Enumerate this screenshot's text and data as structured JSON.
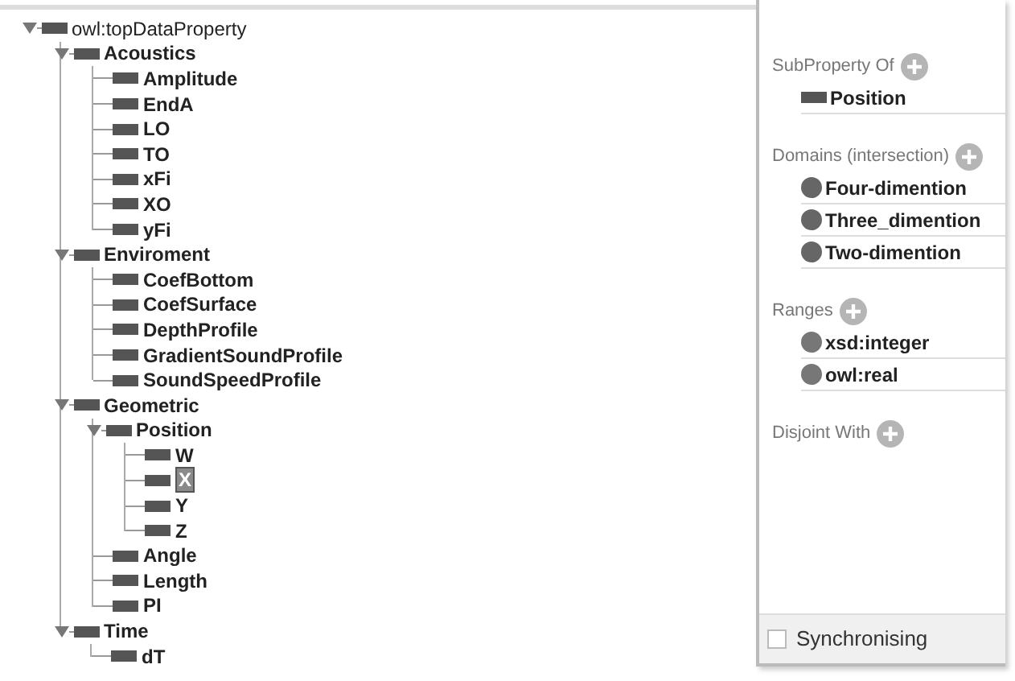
{
  "tree": [
    {
      "label": "owl:topDataProperty",
      "expanded": true,
      "selected": false,
      "children": [
        {
          "label": "Acoustics",
          "expanded": true,
          "selected": false,
          "children": [
            {
              "label": "Amplitude",
              "selected": false
            },
            {
              "label": "EndA",
              "selected": false
            },
            {
              "label": "LO",
              "selected": false
            },
            {
              "label": "TO",
              "selected": false
            },
            {
              "label": "xFi",
              "selected": false
            },
            {
              "label": "XO",
              "selected": false
            },
            {
              "label": "yFi",
              "selected": false
            }
          ]
        },
        {
          "label": "Enviroment",
          "expanded": true,
          "selected": false,
          "children": [
            {
              "label": "CoefBottom",
              "selected": false
            },
            {
              "label": "CoefSurface",
              "selected": false
            },
            {
              "label": "DepthProfile",
              "selected": false
            },
            {
              "label": "GradientSoundProfile",
              "selected": false
            },
            {
              "label": "SoundSpeedProfile",
              "selected": false
            }
          ]
        },
        {
          "label": "Geometric",
          "expanded": true,
          "selected": false,
          "children": [
            {
              "label": "Position",
              "expanded": true,
              "selected": false,
              "children": [
                {
                  "label": "W",
                  "selected": false
                },
                {
                  "label": "X",
                  "selected": true
                },
                {
                  "label": "Y",
                  "selected": false
                },
                {
                  "label": "Z",
                  "selected": false
                }
              ]
            },
            {
              "label": "Angle",
              "selected": false
            },
            {
              "label": "Length",
              "selected": false
            },
            {
              "label": "PI",
              "selected": false
            }
          ]
        },
        {
          "label": "Time",
          "expanded": true,
          "selected": false,
          "children": [
            {
              "label": "dT",
              "selected": false
            }
          ]
        }
      ]
    }
  ],
  "description": {
    "sections": [
      {
        "title": "SubProperty Of",
        "items": [
          {
            "label": "Position",
            "kind": "property"
          }
        ]
      },
      {
        "title": "Domains (intersection)",
        "items": [
          {
            "label": "Four-dimention",
            "kind": "class"
          },
          {
            "label": "Three_dimention",
            "kind": "class"
          },
          {
            "label": "Two-dimention",
            "kind": "class"
          }
        ]
      },
      {
        "title": "Ranges",
        "items": [
          {
            "label": "xsd:integer",
            "kind": "datatype"
          },
          {
            "label": "owl:real",
            "kind": "datatype"
          }
        ]
      },
      {
        "title": "Disjoint With"
      }
    ]
  },
  "synchronising": {
    "label": "Synchronising",
    "checked": false
  }
}
